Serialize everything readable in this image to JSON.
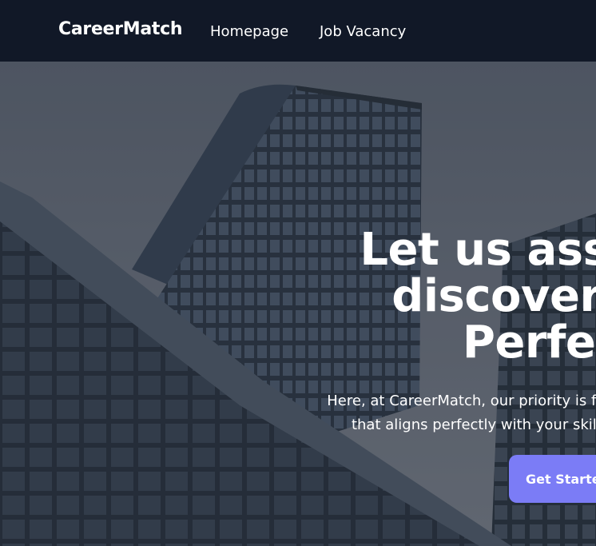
{
  "navbar": {
    "brand": "CareerMatch",
    "links": [
      {
        "label": "Homepage"
      },
      {
        "label": "Job Vacancy"
      }
    ]
  },
  "hero": {
    "title_lines": [
      "Let us assist you in",
      "discovering your",
      "Perfect Job"
    ],
    "description_lines": [
      "Here, at CareerMatch, our priority is finding you a job",
      "that aligns perfectly with your skills and goals."
    ],
    "cta_label": "Get Started"
  },
  "colors": {
    "navbar_bg": "#111827",
    "accent": "#7b7cf6",
    "text": "#ffffff"
  }
}
